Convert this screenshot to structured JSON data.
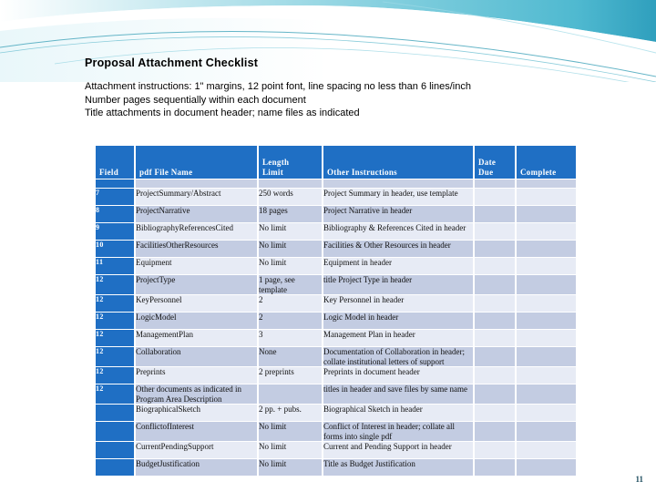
{
  "slide": {
    "title": "Proposal Attachment Checklist",
    "page_number": "11",
    "instructions": [
      "Attachment instructions: 1\" margins, 12 point font, line spacing no less than 6 lines/inch",
      " Number pages sequentially within each document",
      "Title attachments in document header; name files as indicated"
    ]
  },
  "theme": {
    "accent_blue": "#1F6FC4",
    "row_light": "#E7EBF5",
    "row_dark": "#C3CCE2",
    "banner_teal": "#6FC6D8",
    "page_number_color": "#1F4E5F"
  },
  "table": {
    "columns": [
      {
        "key": "field",
        "label": "Field"
      },
      {
        "key": "file",
        "label": "pdf File Name"
      },
      {
        "key": "length",
        "label_line1": "Length",
        "label_line2": "Limit"
      },
      {
        "key": "other",
        "label": "Other Instructions"
      },
      {
        "key": "date",
        "label_line1": "Date",
        "label_line2": "Due"
      },
      {
        "key": "complete",
        "label": "Complete"
      }
    ],
    "rows": [
      {
        "field": "7",
        "file": "ProjectSummary/Abstract",
        "length": "250 words",
        "other": "Project Summary in header, use template",
        "date": "",
        "complete": ""
      },
      {
        "field": "8",
        "file": "ProjectNarrative",
        "length": "18 pages",
        "other": "Project Narrative in header",
        "date": "",
        "complete": ""
      },
      {
        "field": "9",
        "file": "BibliographyReferencesCited",
        "length": "No limit",
        "other": "Bibliography & References Cited in header",
        "date": "",
        "complete": ""
      },
      {
        "field": "10",
        "file": "FacilitiesOtherResources",
        "length": "No limit",
        "other": "Facilities & Other Resources in header",
        "date": "",
        "complete": ""
      },
      {
        "field": "11",
        "file": "Equipment",
        "length": "No limit",
        "other": "Equipment in header",
        "date": "",
        "complete": ""
      },
      {
        "field": "12",
        "file": "ProjectType",
        "length": "1 page, see template",
        "other": "title Project Type in header",
        "date": "",
        "complete": ""
      },
      {
        "field": "12",
        "file": "KeyPersonnel",
        "length": "2",
        "other": "Key Personnel  in header",
        "date": "",
        "complete": ""
      },
      {
        "field": "12",
        "file": "LogicModel",
        "length": "2",
        "other": "Logic Model in header",
        "date": "",
        "complete": ""
      },
      {
        "field": "12",
        "file": "ManagementPlan",
        "length": "3",
        "other": "Management Plan in header",
        "date": "",
        "complete": ""
      },
      {
        "field": "12",
        "file": "Collaboration",
        "length": "None",
        "other": "Documentation of Collaboration in header; collate institutional letters of support",
        "date": "",
        "complete": ""
      },
      {
        "field": "12",
        "file": "Preprints",
        "length": "2 preprints",
        "other": "Preprints in document header",
        "date": "",
        "complete": ""
      },
      {
        "field": "12",
        "file": "Other documents as indicated in Program Area Description",
        "length": "",
        "other": "titles in header and save files by same name",
        "date": "",
        "complete": ""
      },
      {
        "field": "",
        "file": "BiographicalSketch",
        "length": "2 pp. + pubs.",
        "other": "Biographical Sketch in header",
        "date": "",
        "complete": ""
      },
      {
        "field": "",
        "file": "ConflictofInterest",
        "length": "No limit",
        "other": "Conflict of Interest in header; collate all forms into single pdf",
        "date": "",
        "complete": ""
      },
      {
        "field": "",
        "file": "CurrentPendingSupport",
        "length": "No limit",
        "other": "Current and Pending Support in header",
        "date": "",
        "complete": ""
      },
      {
        "field": "",
        "file": "BudgetJustification",
        "length": "No limit",
        "other": " Title as Budget Justification",
        "date": "",
        "complete": ""
      }
    ]
  }
}
